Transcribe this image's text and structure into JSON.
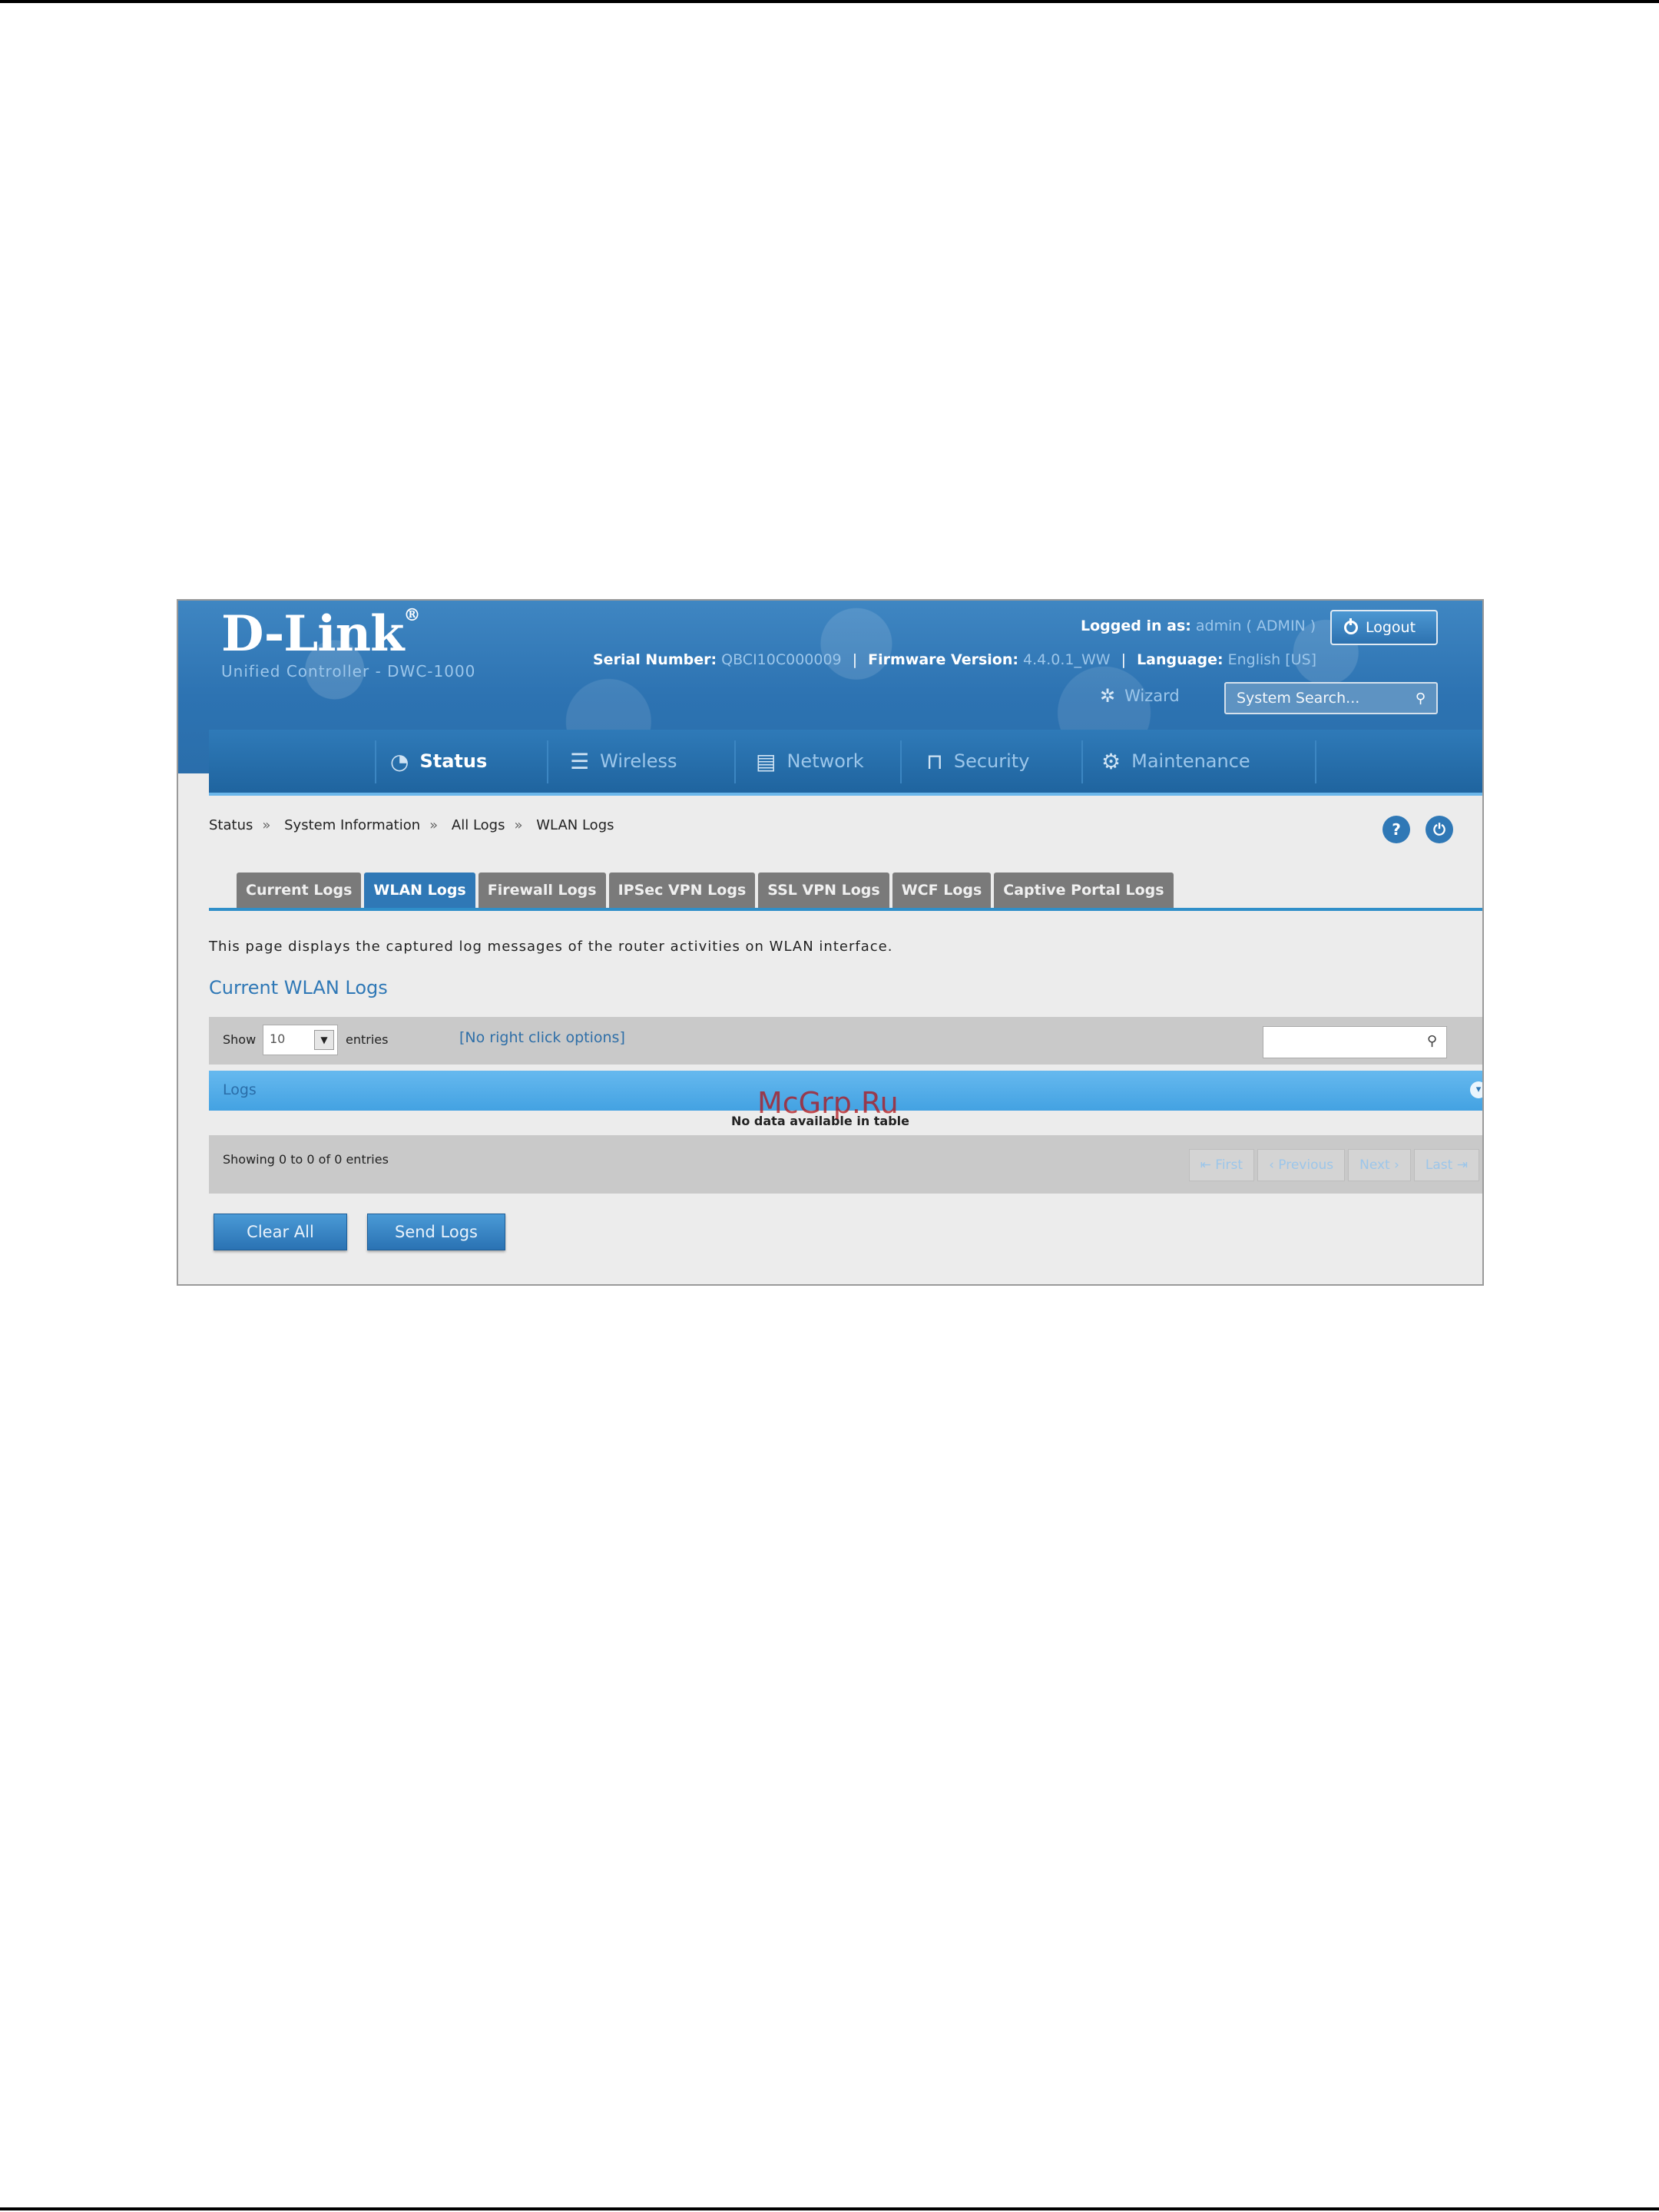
{
  "header": {
    "logo": "D-Link",
    "logo_mark": "®",
    "subtitle": "Unified Controller - DWC-1000",
    "logged_in_label": "Logged in as:",
    "logged_in_value": "admin ( ADMIN )",
    "logout_label": "Logout",
    "serial_label": "Serial Number:",
    "serial_value": "QBCI10C000009",
    "firmware_label": "Firmware Version:",
    "firmware_value": "4.4.0.1_WW",
    "language_label": "Language:",
    "language_value": "English [US]",
    "wizard_label": "Wizard",
    "search_placeholder": "System Search..."
  },
  "nav": {
    "items": [
      {
        "label": "Status",
        "icon": "speedometer-icon",
        "active": true
      },
      {
        "label": "Wireless",
        "icon": "wifi-icon",
        "active": false
      },
      {
        "label": "Network",
        "icon": "server-icon",
        "active": false
      },
      {
        "label": "Security",
        "icon": "lock-icon",
        "active": false
      },
      {
        "label": "Maintenance",
        "icon": "gears-icon",
        "active": false
      }
    ]
  },
  "breadcrumb": {
    "items": [
      "Status",
      "System Information",
      "All Logs",
      "WLAN Logs"
    ],
    "separator": "»"
  },
  "tabs": [
    {
      "label": "Current Logs",
      "active": false
    },
    {
      "label": "WLAN Logs",
      "active": true
    },
    {
      "label": "Firewall Logs",
      "active": false
    },
    {
      "label": "IPSec VPN Logs",
      "active": false
    },
    {
      "label": "SSL VPN Logs",
      "active": false
    },
    {
      "label": "WCF Logs",
      "active": false
    },
    {
      "label": "Captive Portal Logs",
      "active": false
    }
  ],
  "description": "This page displays the captured log messages of the router activities on WLAN interface.",
  "section_title": "Current WLAN Logs",
  "table": {
    "show_label": "Show",
    "show_value": "10",
    "entries_label": "entries",
    "right_click_label": "[No right click options]",
    "column_header": "Logs",
    "empty_message": "No data available in table",
    "showing_text": "Showing 0 to 0 of 0 entries",
    "pager": [
      "First",
      "Previous",
      "Next",
      "Last"
    ]
  },
  "watermark": "McGrp.Ru",
  "buttons": {
    "clear_all": "Clear All",
    "send_logs": "Send Logs"
  }
}
